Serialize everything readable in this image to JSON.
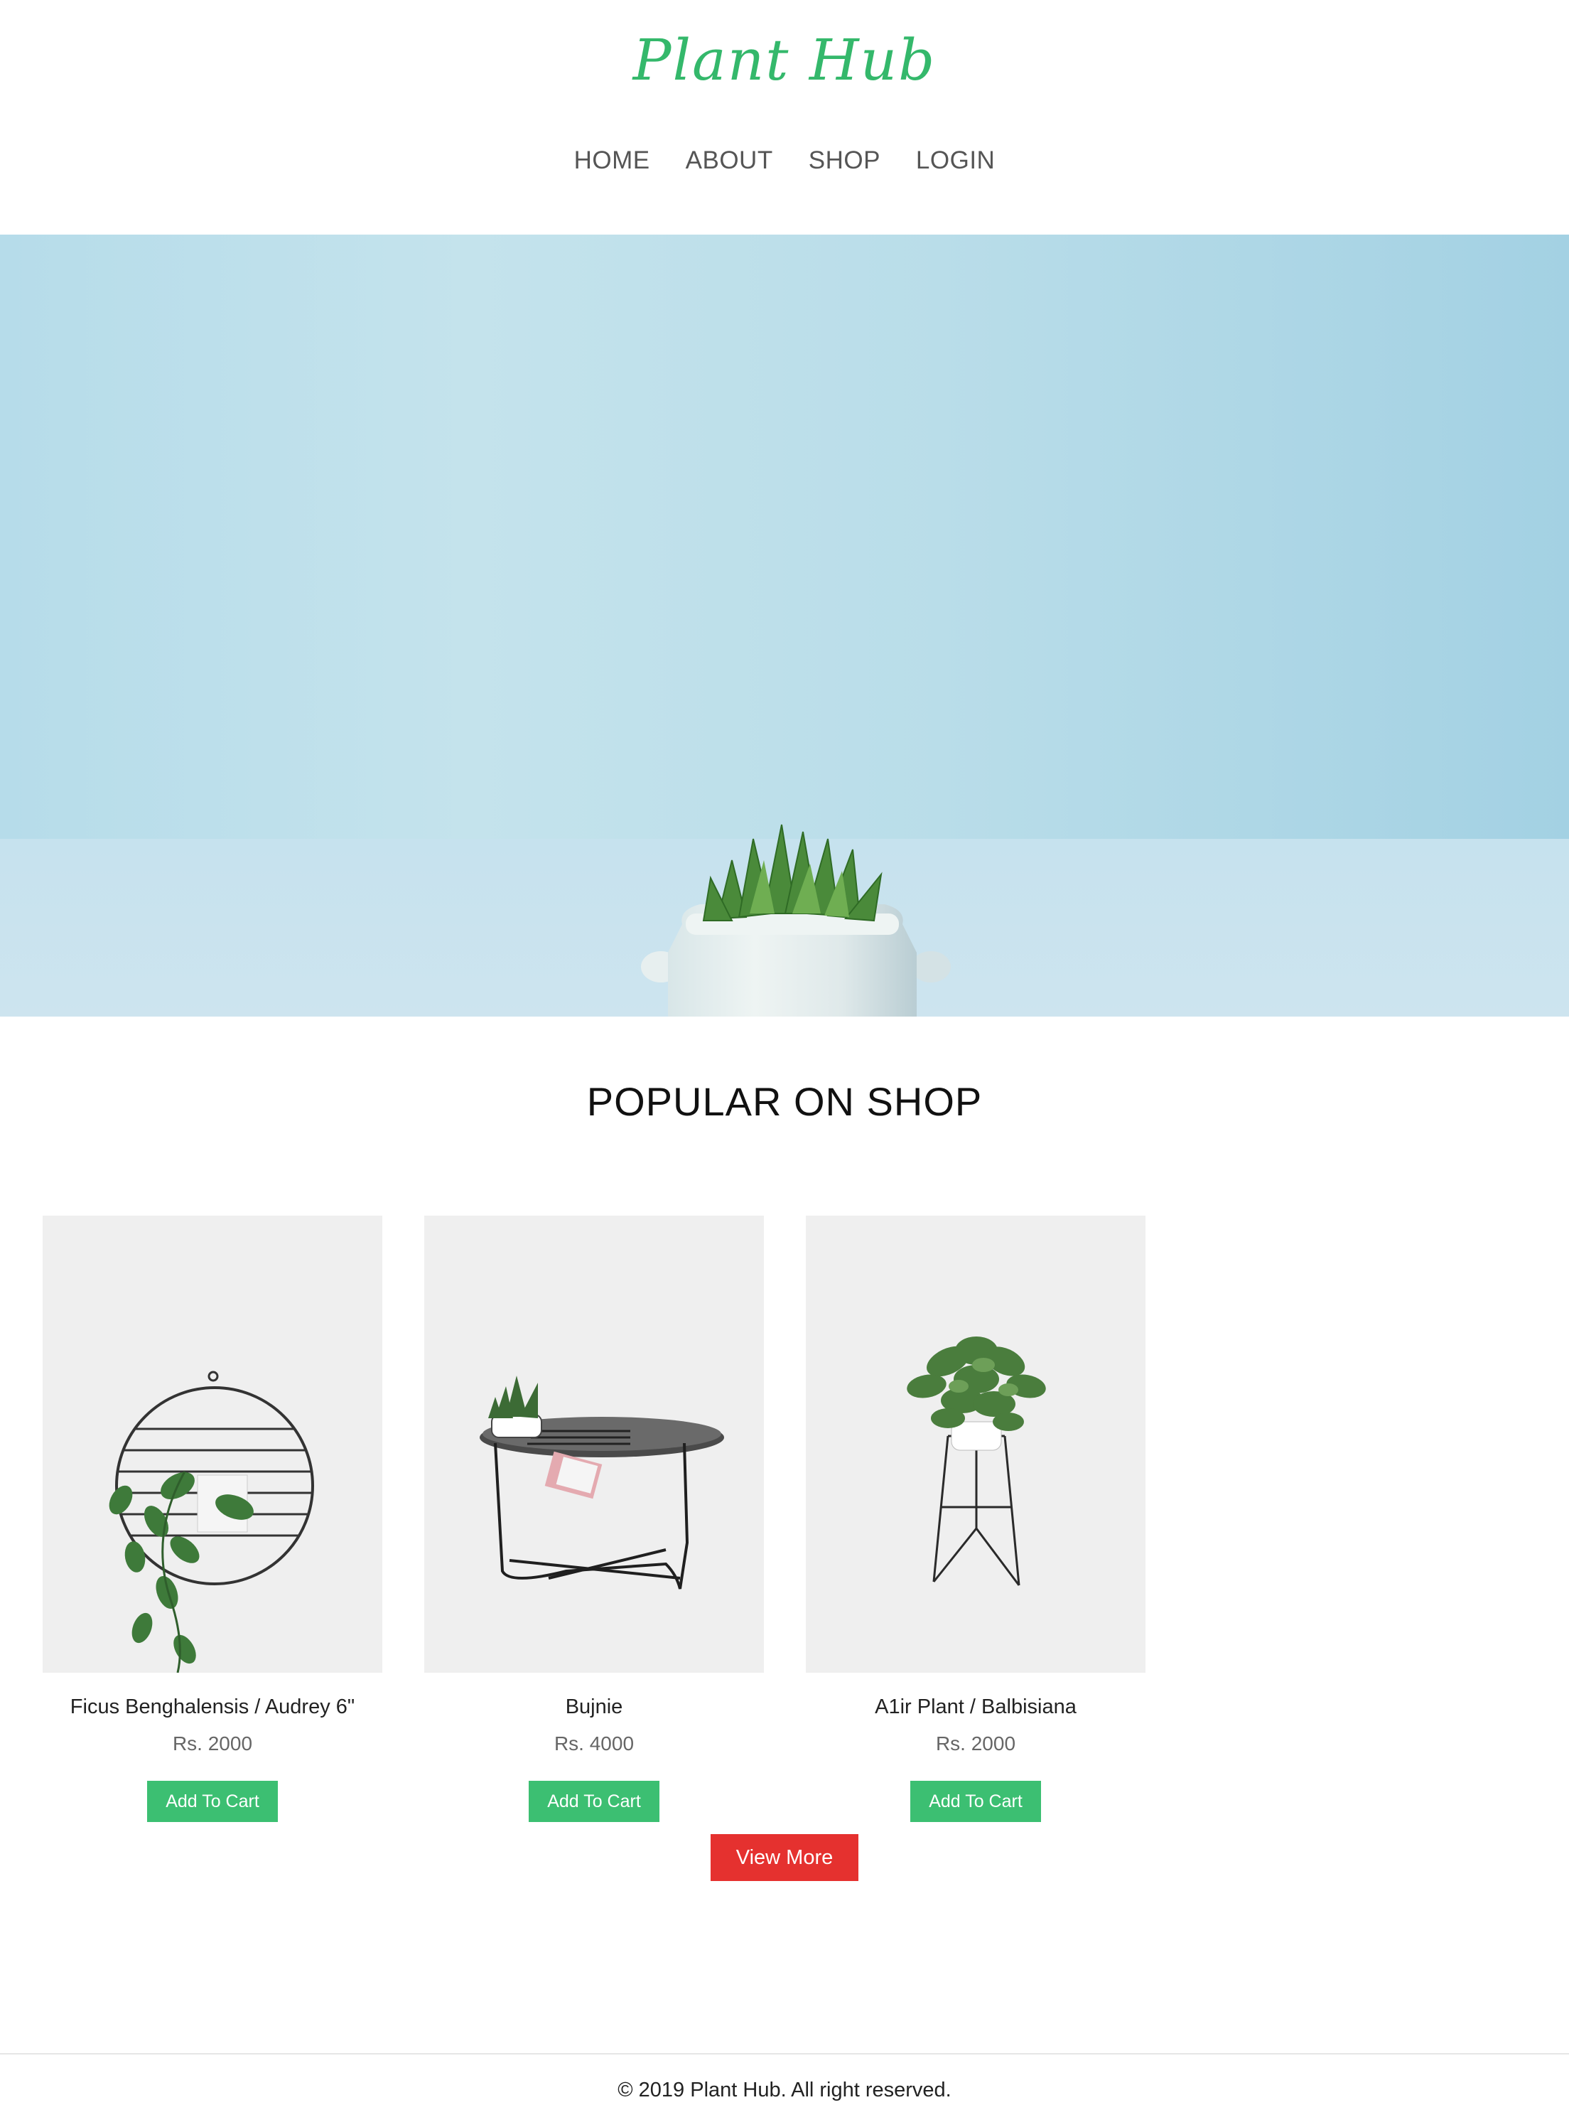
{
  "brand": {
    "name": "Plant Hub",
    "color": "#34b86b"
  },
  "nav": {
    "items": [
      {
        "label": "HOME"
      },
      {
        "label": "ABOUT"
      },
      {
        "label": "SHOP"
      },
      {
        "label": "LOGIN"
      }
    ]
  },
  "hero": {
    "image": "succulent-in-white-pot-on-light-blue-background",
    "background_color": "#b9dde9"
  },
  "popular": {
    "title": "POPULAR ON SHOP",
    "products": [
      {
        "name": "Ficus Benghalensis / Audrey 6\"",
        "price": "Rs. 2000",
        "button_label": "Add To Cart",
        "image": "hanging-pothos-wall-ring"
      },
      {
        "name": "Bujnie",
        "price": "Rs. 4000",
        "button_label": "Add To Cart",
        "image": "side-table-with-plant"
      },
      {
        "name": "A1ir Plant / Balbisiana",
        "price": "Rs. 2000",
        "button_label": "Add To Cart",
        "image": "plant-on-wire-stand"
      }
    ],
    "view_more_label": "View More",
    "cart_button_color": "#3cbf72",
    "view_more_color": "#e5312f"
  },
  "footer": {
    "copyright": "© 2019 Plant Hub. All right reserved."
  }
}
